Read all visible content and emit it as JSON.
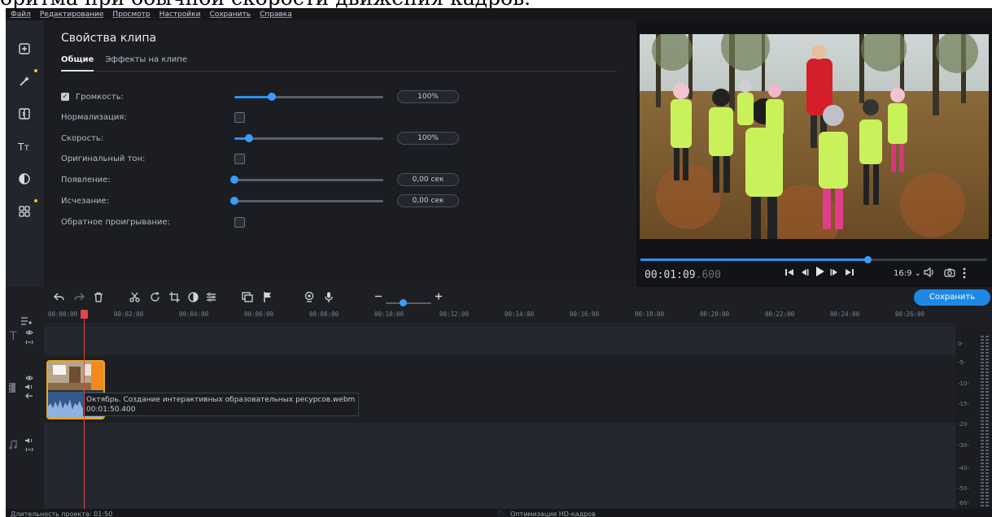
{
  "caption": "оритма при обычной скорости движения кадров.",
  "menu": [
    "Файл",
    "Редактирование",
    "Просмотр",
    "Настройки",
    "Сохранить",
    "Справка"
  ],
  "toolbar_icons": [
    "import-icon",
    "magic-wand-icon",
    "transitions-icon",
    "titles-icon",
    "filters-icon",
    "more-tools-icon"
  ],
  "props": {
    "title": "Свойства клипа",
    "tabs": [
      "Общие",
      "Эффекты на клипе"
    ],
    "volume_label": "Громкость:",
    "volume_value": "100%",
    "volume_level": 0.25,
    "normalize_label": "Нормализация:",
    "speed_label": "Скорость:",
    "speed_value": "100%",
    "speed_level": 0.1,
    "original_tone_label": "Оригинальный тон:",
    "fade_in_label": "Появление:",
    "fade_in_value": "0,00 сек",
    "fade_out_label": "Исчезание:",
    "fade_out_value": "0,00 сек",
    "reverse_label": "Обратное проигрывание:"
  },
  "preview": {
    "timecode": "00:01:09",
    "timecode_ms": ".600",
    "seek_progress": 0.655,
    "aspect": "16:9 ⌄"
  },
  "save_label": "Сохранить",
  "ruler_ticks": [
    "00:00:00",
    "00:02:00",
    "00:04:00",
    "00:06:00",
    "00:08:00",
    "00:10:00",
    "00:12:00",
    "00:14:00",
    "00:16:00",
    "00:18:00",
    "00:20:00",
    "00:22:00",
    "00:24:00",
    "00:26:00"
  ],
  "clip": {
    "name": "Октябрь. Создание интерактивных образовательных ресурсов.webm",
    "duration": "00:01:50.400"
  },
  "meter_labels": [
    "0-",
    "-5-",
    "-10-",
    "-15-",
    "-20-",
    "-30-",
    "-40-",
    "-50-",
    "-60-"
  ],
  "status": {
    "duration": "Длительность проекта: 01:50",
    "optimize": "Оптимизация HD-кадров"
  }
}
